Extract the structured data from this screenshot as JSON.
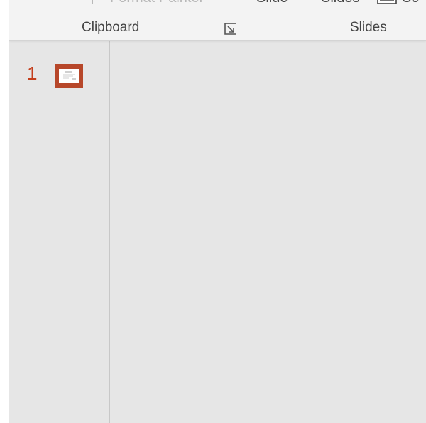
{
  "ribbon": {
    "clipboard_group": {
      "format_painter_label": "Format Painter",
      "label": "Clipboard"
    },
    "slides_group": {
      "new_slide_label": "Slide",
      "reuse_slides_label": "Slides",
      "section_label": "Se",
      "label": "Slides"
    }
  },
  "thumbnail_pane": {
    "slides": [
      {
        "number": "1"
      }
    ]
  },
  "colors": {
    "accent": "#b7472a",
    "slide_number": "#c43e1c",
    "ribbon_bg": "#f3f3f3",
    "workspace_bg": "#e6e6e6"
  }
}
